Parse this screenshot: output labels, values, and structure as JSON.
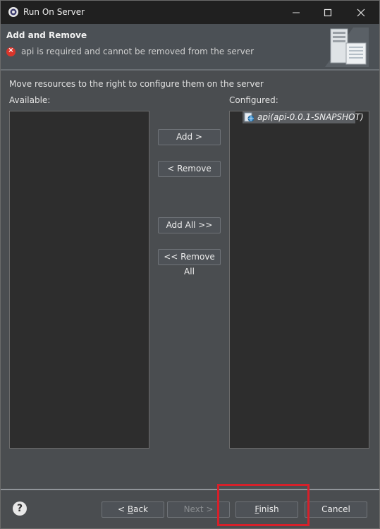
{
  "window": {
    "title": "Run On Server",
    "controls": [
      "minimize",
      "maximize",
      "close"
    ]
  },
  "header": {
    "title": "Add and Remove",
    "message": "api is required and cannot be removed from the server",
    "message_icon": "error-icon"
  },
  "main": {
    "instruction": "Move resources to the right to configure them on the server",
    "available_label": "Available:",
    "available_items": [],
    "configured_label": "Configured:",
    "configured_items": [
      {
        "label": "api(api-0.0.1-SNAPSHOT)",
        "icon": "web-module-icon",
        "selected": true
      }
    ],
    "buttons": {
      "add": "Add >",
      "remove": "< Remove",
      "add_all": "Add All >>",
      "remove_all": "<< Remove All"
    }
  },
  "footer": {
    "help_icon": "help-icon",
    "back": {
      "prefix": "< ",
      "mnemonic": "B",
      "rest": "ack"
    },
    "next": "Next >",
    "finish": {
      "mnemonic": "F",
      "rest": "inish"
    },
    "cancel": "Cancel"
  },
  "colors": {
    "accent_highlight": "#d6202a",
    "error": "#d9352b",
    "dialog_bg": "#4a4d50",
    "list_bg": "#2d2d2d"
  }
}
